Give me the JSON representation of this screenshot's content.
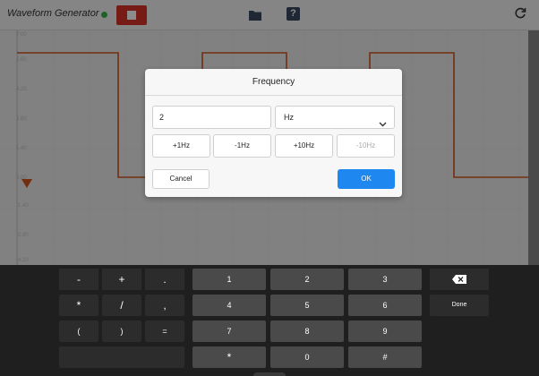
{
  "app": {
    "title": "Waveform Generator"
  },
  "graph": {
    "y_ticks": [
      "7.00",
      "5.60",
      "4.20",
      "2.80",
      "1.40",
      "0.00",
      "-1.40",
      "-2.80",
      "-4.20"
    ],
    "trace_color": "#d2541f"
  },
  "dialog": {
    "title": "Frequency",
    "value": "2",
    "unit": "Hz",
    "steps": [
      "+1Hz",
      "-1Hz",
      "+10Hz",
      "-10Hz"
    ],
    "cancel": "Cancel",
    "ok": "OK"
  },
  "keyboard": {
    "row1": [
      "-",
      "+",
      ".",
      "1",
      "2",
      "3"
    ],
    "row2": [
      "*",
      "/",
      ",",
      "4",
      "5",
      "6"
    ],
    "row3": [
      "(",
      ")",
      "=",
      "7",
      "8",
      "9"
    ],
    "row4": [
      "*",
      "0",
      "#"
    ],
    "done": "Done"
  }
}
